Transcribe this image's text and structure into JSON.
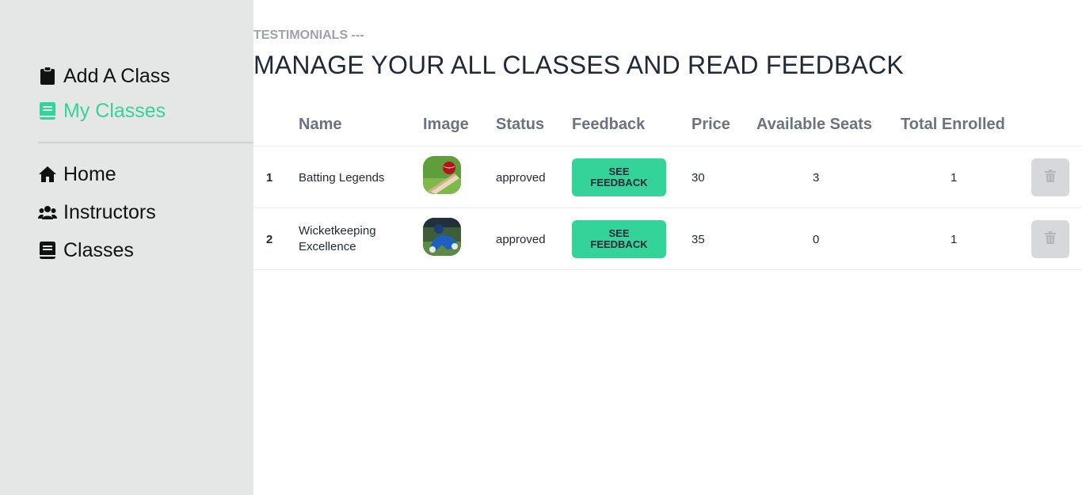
{
  "sidebar": {
    "dashboard_items": [
      {
        "label": "Add A Class",
        "icon": "clipboard-icon",
        "active": false
      },
      {
        "label": "My Classes",
        "icon": "book-icon",
        "active": true
      }
    ],
    "nav_items": [
      {
        "label": "Home",
        "icon": "home-icon"
      },
      {
        "label": "Instructors",
        "icon": "users-icon"
      },
      {
        "label": "Classes",
        "icon": "book-icon"
      }
    ]
  },
  "header": {
    "eyebrow": "TESTIMONIALS ---",
    "title": "MANAGE YOUR ALL CLASSES AND READ FEEDBACK"
  },
  "table": {
    "columns": [
      "Name",
      "Image",
      "Status",
      "Feedback",
      "Price",
      "Available Seats",
      "Total Enrolled"
    ],
    "rows": [
      {
        "index": "1",
        "name": "Batting Legends",
        "image": "cricket-ball-on-bat",
        "status": "approved",
        "feedback_label": "SEE FEEDBACK",
        "price": "30",
        "available_seats": "3",
        "total_enrolled": "1"
      },
      {
        "index": "2",
        "name": "Wicketkeeping Excellence",
        "image": "wicketkeeper-in-blue",
        "status": "approved",
        "feedback_label": "SEE FEEDBACK",
        "price": "35",
        "available_seats": "0",
        "total_enrolled": "1"
      }
    ]
  },
  "colors": {
    "accent": "#34d399",
    "sidebar_bg": "#e5e7e6",
    "delete_button_bg": "#d7d8db"
  }
}
